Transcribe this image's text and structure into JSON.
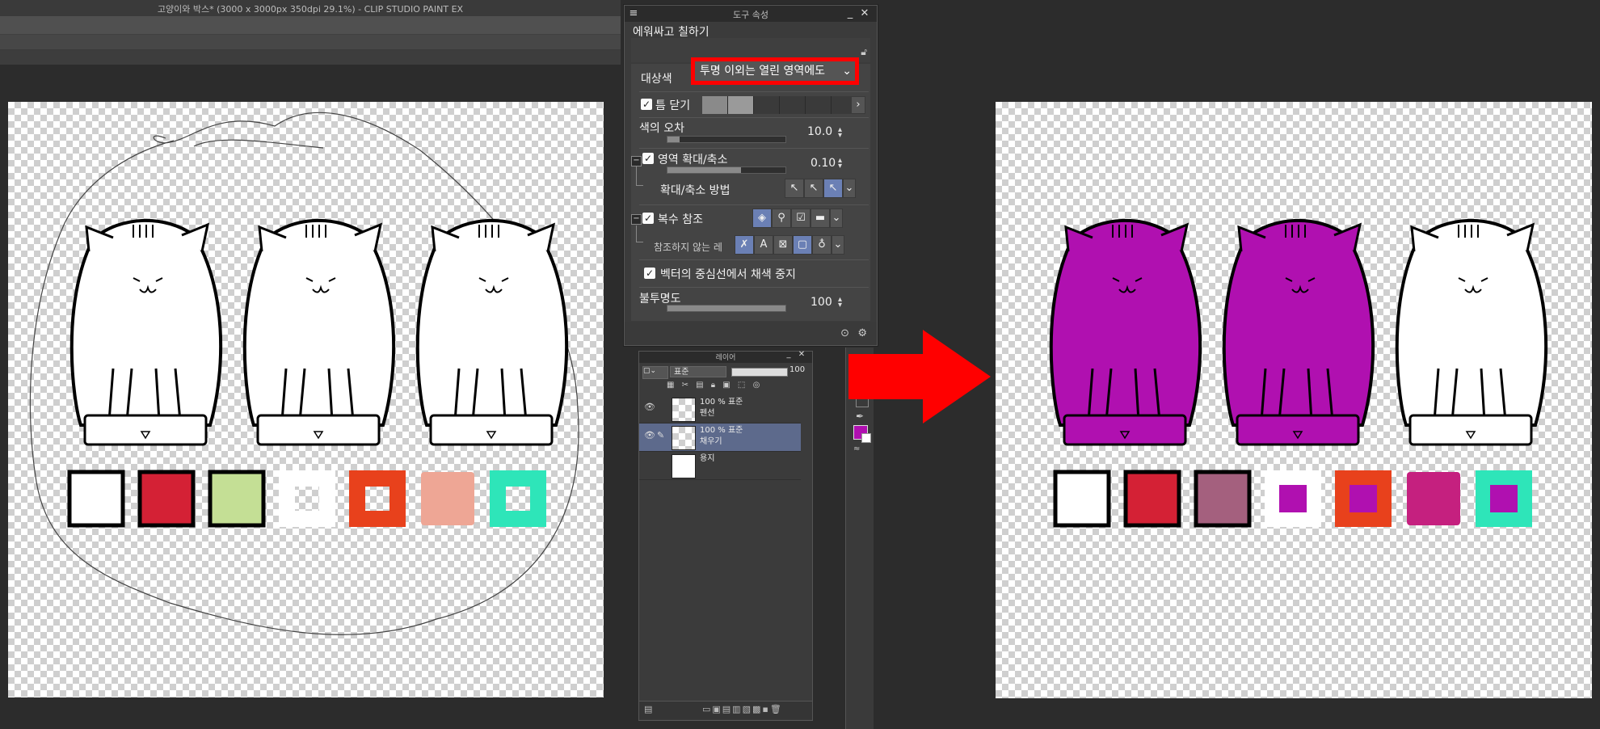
{
  "app": {
    "title": "고양이와 박스* (3000 x 3000px 350dpi 29.1%)  - CLIP STUDIO PAINT EX"
  },
  "tool_property": {
    "panel_title": "도구 속성",
    "tool_name": "에워싸고 칠하기",
    "target_color": {
      "label": "대상색",
      "value": "투명 이외는 열린 영역에도"
    },
    "close_gap": {
      "label": "틈 닫기",
      "checked": true
    },
    "color_margin": {
      "label": "색의 오차",
      "value": "10.0",
      "fraction": 0.1
    },
    "area_scaling": {
      "label": "영역 확대/축소",
      "checked": true,
      "value": "0.10",
      "fraction": 0.62
    },
    "scaling_method": {
      "label": "확대/축소 방법"
    },
    "refer_multiple": {
      "label": "복수 참조",
      "checked": true
    },
    "layer_not_referenced": {
      "label": "참조하지 않는 레"
    },
    "vector_stop": {
      "label": "벡터의 중심선에서 채색 중지",
      "checked": true
    },
    "opacity": {
      "label": "불투명도",
      "value": "100",
      "fraction": 1.0
    }
  },
  "layer_panel": {
    "title": "레이어",
    "blend_mode": "표준",
    "opacity": "100",
    "layers": [
      {
        "info": "100 % 표준",
        "name": "펜선",
        "visible": true,
        "selected": false
      },
      {
        "info": "100 % 표준",
        "name": "채우기",
        "visible": true,
        "selected": true
      },
      {
        "info": "",
        "name": "용지",
        "visible": false,
        "selected": false
      }
    ]
  },
  "colors": {
    "fill": "#b010b0",
    "highlight": "#ff0000",
    "swatches": [
      "#ffffff",
      "#d42135",
      "#c4df95",
      "#ffffff",
      "#e8411c",
      "#eea695",
      "#2ee5b9"
    ],
    "swatches_after": [
      "#ffffff",
      "#d42135",
      "#a4607e",
      "#ffffff",
      "#e8411c",
      "#c5207f",
      "#2ee5b9"
    ]
  },
  "icons": [
    "lock-icon",
    "checkbox-icon",
    "chevron-down-icon",
    "chevron-right-icon",
    "eye-icon",
    "pen-icon",
    "arrow-right-icon"
  ]
}
